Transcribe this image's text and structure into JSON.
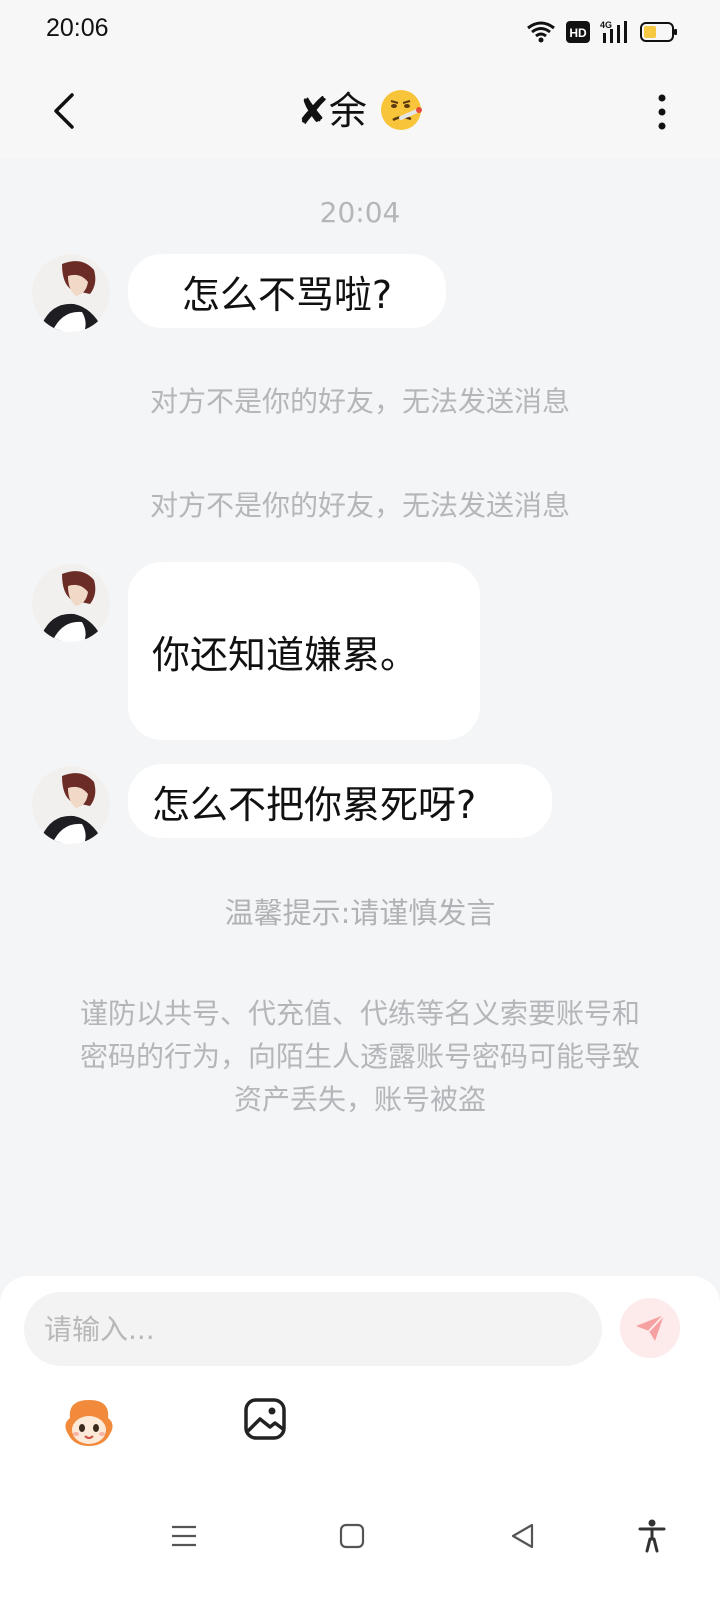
{
  "status_bar": {
    "time": "20:06",
    "network": "4G",
    "hd_badge": "HD",
    "icons": [
      "wifi-icon",
      "hd-icon",
      "signal-4g-icon",
      "battery-icon"
    ]
  },
  "header": {
    "title_prefix": "✘",
    "title_name": "余",
    "title_emoji": "face-with-thermometer",
    "icons": [
      "back-arrow-icon",
      "more-vertical-icon"
    ]
  },
  "chat": {
    "timestamp": "20:04",
    "messages": [
      {
        "text": "怎么不骂啦?"
      },
      {
        "text": "你还知道嫌累。"
      },
      {
        "text": "怎么不把你累死呀?"
      }
    ],
    "system_messages": [
      "对方不是你的好友，无法发送消息",
      "对方不是你的好友，无法发送消息"
    ],
    "tip_title": "温馨提示:请谨慎发言",
    "tip_body": "谨防以共号、代充值、代练等名义索要账号和密码的行为，向陌生人透露账号密码可能导致资产丢失，账号被盗"
  },
  "input": {
    "placeholder": "请输入...",
    "icons": [
      "send-icon",
      "emoji-mascot-icon",
      "image-icon"
    ]
  },
  "nav_bar": {
    "icons": [
      "menu-icon",
      "home-icon",
      "back-icon",
      "accessibility-icon"
    ]
  },
  "colors": {
    "background": "#f4f5f7",
    "bubble": "#ffffff",
    "system_text": "#b4b6ba",
    "send_button": "#fdeaea",
    "send_icon": "#f6a1a1"
  }
}
